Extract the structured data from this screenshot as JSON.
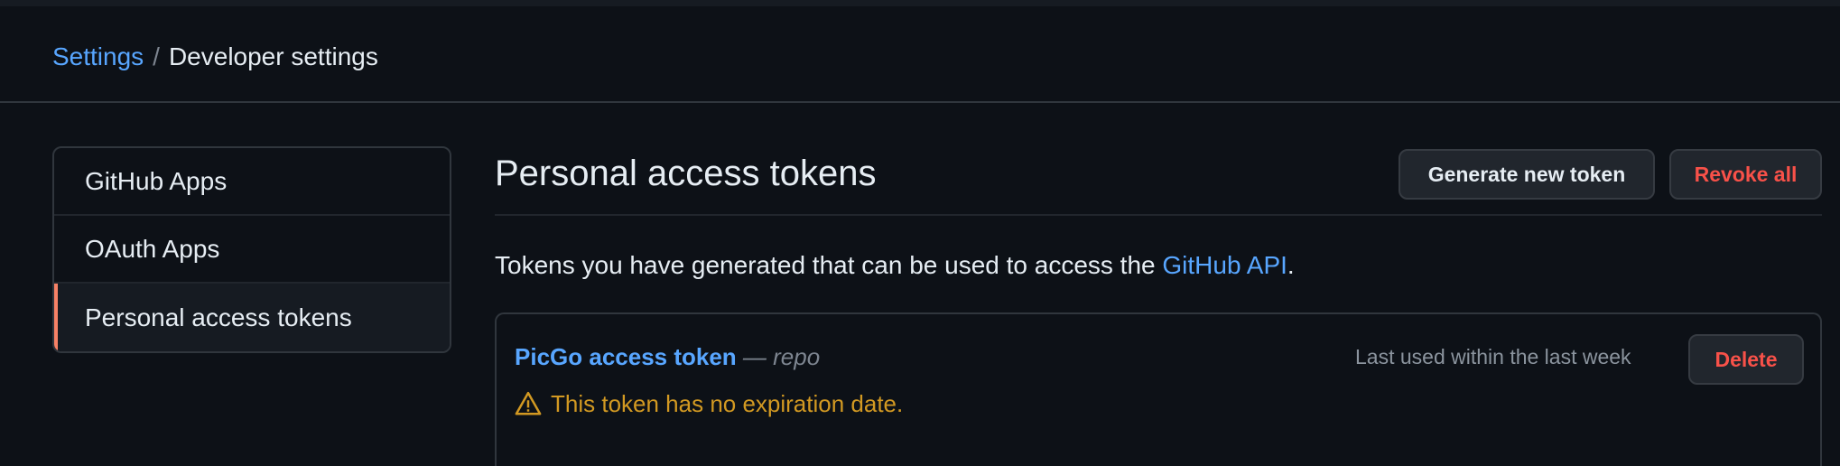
{
  "breadcrumb": {
    "root": "Settings",
    "separator": "/",
    "current": "Developer settings"
  },
  "sidebar": {
    "items": [
      {
        "label": "GitHub Apps",
        "active": false
      },
      {
        "label": "OAuth Apps",
        "active": false
      },
      {
        "label": "Personal access tokens",
        "active": true
      }
    ]
  },
  "main": {
    "title": "Personal access tokens",
    "generate_button": "Generate new token",
    "revoke_button": "Revoke all",
    "description_prefix": "Tokens you have generated that can be used to access the ",
    "description_link": "GitHub API",
    "description_suffix": "."
  },
  "tokens": [
    {
      "name": "PicGo access token",
      "separator": " — ",
      "scope": "repo",
      "last_used": "Last used within the last week",
      "delete_label": "Delete",
      "warning": "This token has no expiration date.",
      "warning_icon": "alert-triangle-icon"
    }
  ],
  "colors": {
    "background": "#0d1117",
    "link": "#58a6ff",
    "danger": "#f85149",
    "warning": "#d29922",
    "active_indicator": "#f78166"
  }
}
